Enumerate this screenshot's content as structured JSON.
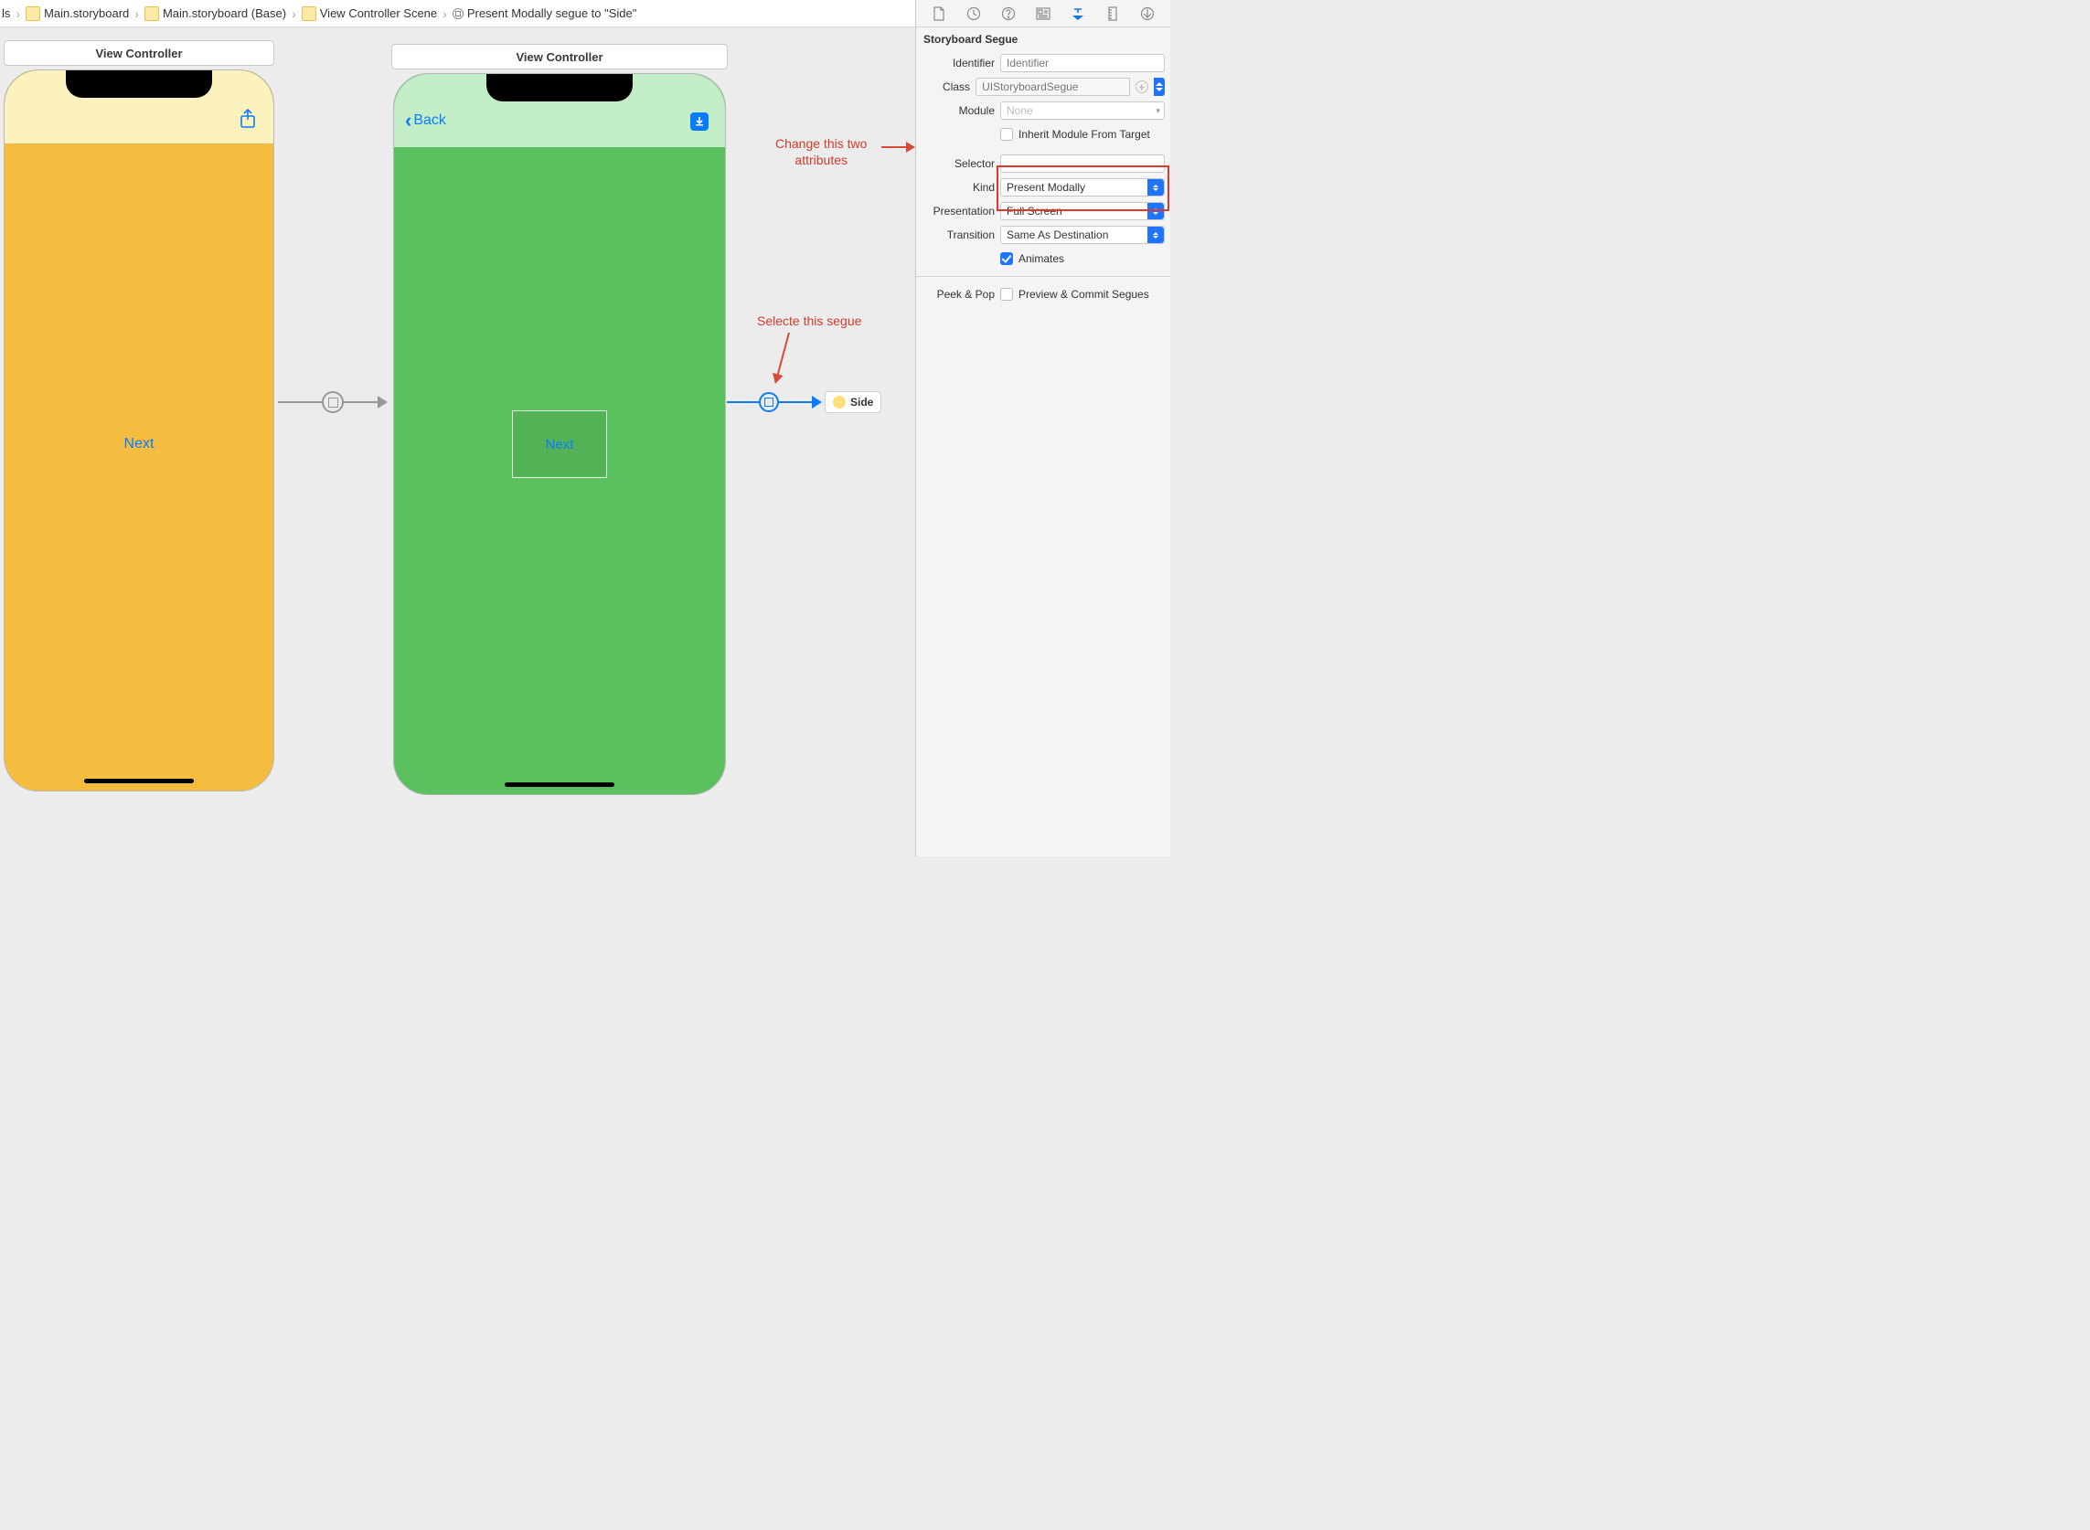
{
  "breadcrumb": {
    "item0": "ls",
    "item1": "Main.storyboard",
    "item2": "Main.storyboard (Base)",
    "item3": "View Controller Scene",
    "item4": "Present Modally segue to \"Side\""
  },
  "scene_titles": {
    "first": "View Controller",
    "second": "View Controller"
  },
  "phone1": {
    "next": "Next"
  },
  "phone2": {
    "back": "Back",
    "next": "Next"
  },
  "side_ref": {
    "label": "Side"
  },
  "annotations": {
    "attrs": "Change this two\nattributes",
    "segue": "Selecte this segue"
  },
  "inspector": {
    "heading": "Storyboard Segue",
    "labels": {
      "identifier": "Identifier",
      "class": "Class",
      "module": "Module",
      "inherit": "Inherit Module From Target",
      "selector": "Selector",
      "kind": "Kind",
      "presentation": "Presentation",
      "transition": "Transition",
      "animates": "Animates",
      "peekpop": "Peek & Pop",
      "preview": "Preview & Commit Segues"
    },
    "placeholders": {
      "identifier": "Identifier",
      "class": "UIStoryboardSegue",
      "module": "None"
    },
    "values": {
      "kind": "Present Modally",
      "presentation": "Full Screen",
      "transition": "Same As Destination"
    }
  }
}
